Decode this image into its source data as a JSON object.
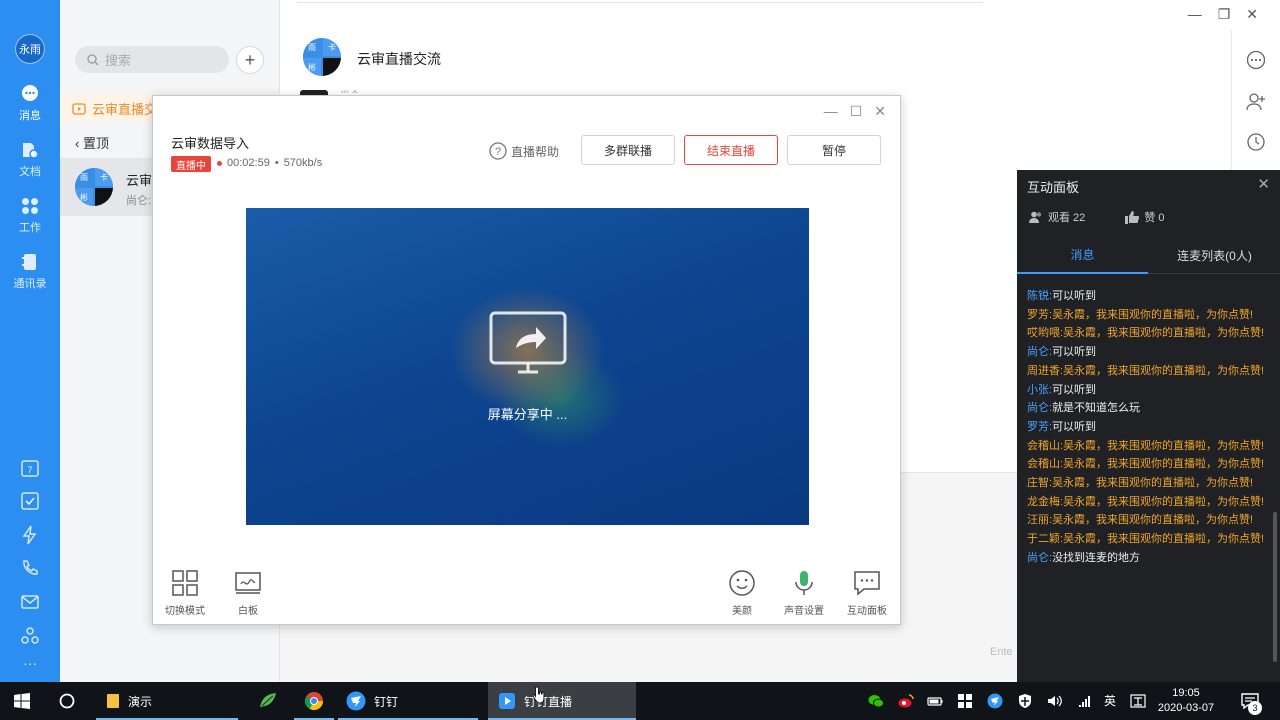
{
  "app": {
    "avatar_text": "永雨",
    "nav": [
      {
        "label": "消息",
        "icon": "chat-icon"
      },
      {
        "label": "文档",
        "icon": "document-icon"
      },
      {
        "label": "工作",
        "icon": "work-grid-icon"
      },
      {
        "label": "通讯录",
        "icon": "contacts-icon"
      }
    ],
    "nav_bottom_icons": [
      "calendar-icon",
      "todo-check-icon",
      "ding-lightning-icon",
      "phone-icon",
      "mail-icon",
      "recycle-icon",
      "more-icon"
    ],
    "calendar_day": "7",
    "more_dots": "···"
  },
  "list": {
    "search_placeholder": "搜索",
    "add_label": "+",
    "notice_text": "云审直播交流",
    "pinned_label": "置顶",
    "conversation": {
      "name": "云审",
      "preview": "尚仑:",
      "avatar_quads": [
        "雨",
        "卡",
        "彬",
        ""
      ]
    }
  },
  "chat": {
    "title": "云审直播交流",
    "avatar_quads": [
      "雨",
      "卡",
      "彬",
      ""
    ],
    "partial_text": "尚仑",
    "enter_hint": "Ente"
  },
  "live": {
    "title": "云审数据导入",
    "badge": "直播中",
    "elapsed": "00:02:59",
    "separator": "•",
    "bitrate": "570kb/s",
    "help_label": "直播帮助",
    "btn_multi": "多群联播",
    "btn_end": "结束直播",
    "btn_pause": "暂停",
    "share_text": "屏幕分享中 ...",
    "tools_left": [
      {
        "label": "切换模式",
        "icon": "switch-mode-icon"
      },
      {
        "label": "白板",
        "icon": "whiteboard-icon"
      }
    ],
    "tools_right": [
      {
        "label": "美颜",
        "icon": "beauty-face-icon"
      },
      {
        "label": "声音设置",
        "icon": "microphone-icon"
      },
      {
        "label": "互动面板",
        "icon": "interaction-panel-icon"
      }
    ]
  },
  "panel": {
    "title": "互动面板",
    "viewers_label": "观看 22",
    "likes_label": "赞 0",
    "tab_messages": "消息",
    "tab_mic": "连麦列表(0人)",
    "messages": [
      {
        "name": "陈锐:",
        "text": "可以听到",
        "style": "plain"
      },
      {
        "name": "罗芳:",
        "text": "吴永霞，我来围观你的直播啦，为你点赞!",
        "style": "highlight"
      },
      {
        "name": "哎哟喂:",
        "text": "吴永霞，我来围观你的直播啦，为你点赞!",
        "style": "highlight"
      },
      {
        "name": "尚仑:",
        "text": "可以听到",
        "style": "plain"
      },
      {
        "name": "周进香:",
        "text": "吴永霞，我来围观你的直播啦，为你点赞!",
        "style": "highlight"
      },
      {
        "name": "小张:",
        "text": "可以听到",
        "style": "plain"
      },
      {
        "name": "尚仑:",
        "text": "就是不知道怎么玩",
        "style": "plain"
      },
      {
        "name": "罗芳:",
        "text": "可以听到",
        "style": "plain"
      },
      {
        "name": "会稽山:",
        "text": "吴永霞，我来围观你的直播啦，为你点赞!",
        "style": "highlight"
      },
      {
        "name": "会稽山:",
        "text": "吴永霞，我来围观你的直播啦，为你点赞!",
        "style": "highlight"
      },
      {
        "name": "庄智:",
        "text": "吴永霞，我来围观你的直播啦，为你点赞!",
        "style": "highlight"
      },
      {
        "name": "龙金梅:",
        "text": "吴永霞，我来围观你的直播啦，为你点赞!",
        "style": "highlight"
      },
      {
        "name": "汪丽:",
        "text": "吴永霞，我来围观你的直播啦，为你点赞!",
        "style": "highlight"
      },
      {
        "name": "于二颖:",
        "text": "吴永霞，我来围观你的直播啦，为你点赞!",
        "style": "highlight"
      },
      {
        "name": "尚仑:",
        "text": "没找到连麦的地方",
        "style": "plain"
      }
    ]
  },
  "taskbar": {
    "apps": [
      {
        "label": "演示",
        "icon": "folder-icon"
      },
      {
        "label": "",
        "icon": "plant-app-icon"
      },
      {
        "label": "",
        "icon": "chrome-icon"
      },
      {
        "label": "钉钉",
        "icon": "dingtalk-icon"
      },
      {
        "label": "钉钉直播",
        "icon": "dingtalk-live-icon"
      }
    ],
    "ime": "英",
    "clock_time": "19:05",
    "clock_date": "2020-03-07",
    "notification_count": "3"
  }
}
